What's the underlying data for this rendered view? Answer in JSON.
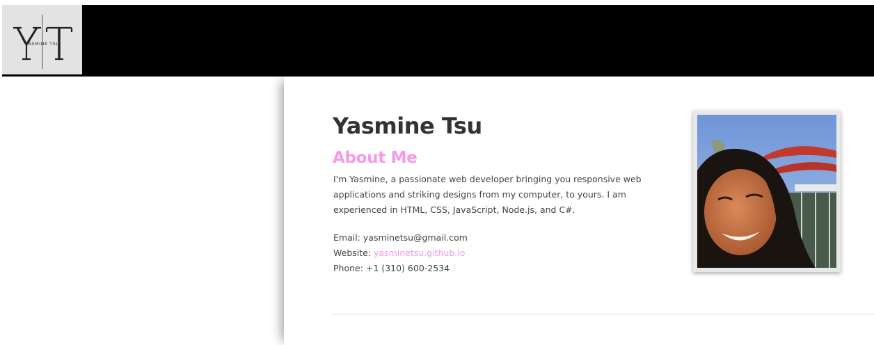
{
  "header": {
    "logo": {
      "letters": "Y T",
      "subtitle": "YASMINE TSU",
      "icon": "yt-monogram-logo"
    }
  },
  "profile": {
    "name": "Yasmine Tsu",
    "about_title": "About Me",
    "about_text": "I'm Yasmine, a passionate web developer bringing you responsive web applications and striking designs from my computer, to yours. I am experienced in HTML, CSS, JavaScript, Node.js, and C#.",
    "email_label": "Email:",
    "email_value": "yasminetsu@gmail.com",
    "website_label": "Website:",
    "website_value": "yasminetsu.github.io",
    "phone_label": "Phone:",
    "phone_value": "+1 (310) 600-2534",
    "photo_icon": "profile-photo"
  },
  "colors": {
    "navbar": "#000000",
    "accent": "#f49ae8",
    "name": "#333333",
    "text": "#444444",
    "logo_bg": "#e3e3e3"
  }
}
